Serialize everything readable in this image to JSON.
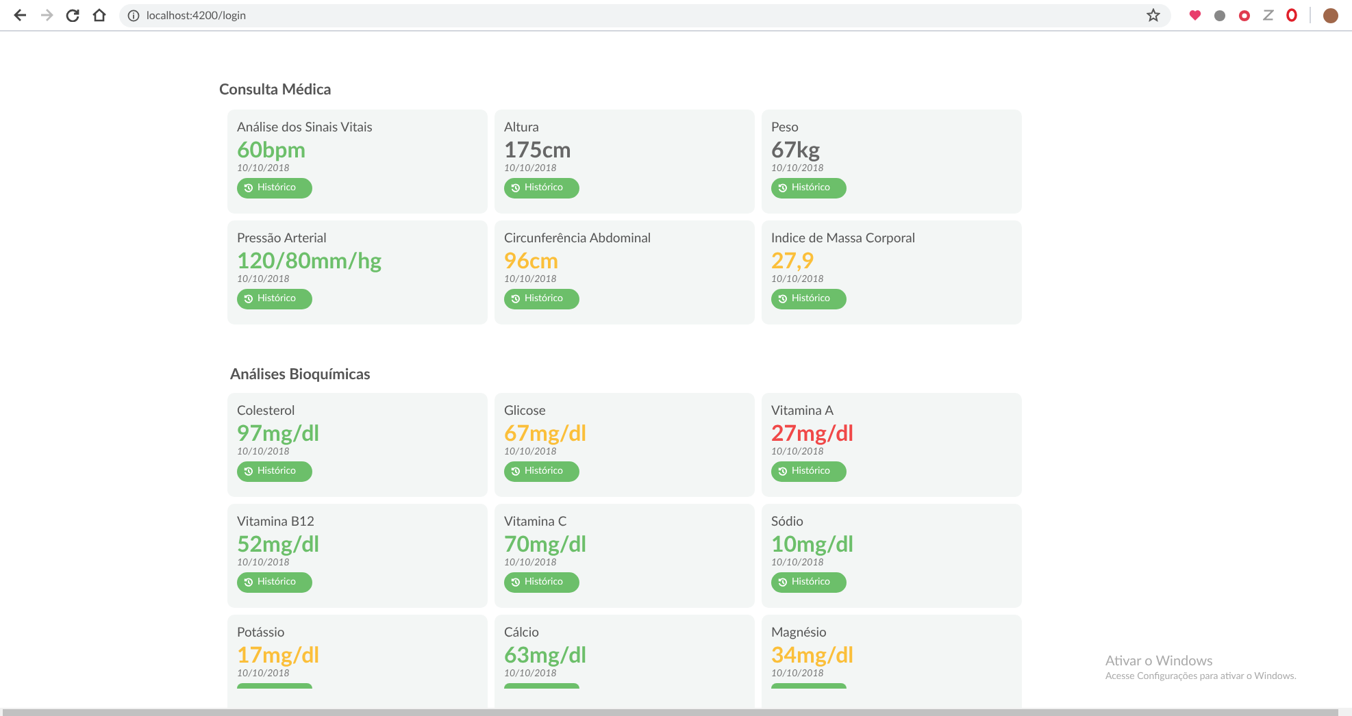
{
  "browser": {
    "url": "localhost:4200/login"
  },
  "sections": [
    {
      "title": "Consulta Médica",
      "cards": [
        {
          "label": "Análise dos Sinais Vitais",
          "value": "60bpm",
          "color": "#6cbf6a",
          "date": "10/10/2018",
          "button": "Histórico"
        },
        {
          "label": "Altura",
          "value": "175cm",
          "color": "#666666",
          "date": "10/10/2018",
          "button": "Histórico"
        },
        {
          "label": "Peso",
          "value": "67kg",
          "color": "#666666",
          "date": "10/10/2018",
          "button": "Histórico"
        },
        {
          "label": "Pressão Arterial",
          "value": "120/80mm/hg",
          "color": "#6cbf6a",
          "date": "10/10/2018",
          "button": "Histórico"
        },
        {
          "label": "Circunferência Abdominal",
          "value": "96cm",
          "color": "#fbbf3a",
          "date": "10/10/2018",
          "button": "Histórico"
        },
        {
          "label": "Indice de Massa Corporal",
          "value": "27,9",
          "color": "#fbbf3a",
          "date": "10/10/2018",
          "button": "Histórico"
        }
      ]
    },
    {
      "title": "Análises Bioquímicas",
      "cards": [
        {
          "label": "Colesterol",
          "value": "97mg/dl",
          "color": "#6cbf6a",
          "date": "10/10/2018",
          "button": "Histórico"
        },
        {
          "label": "Glicose",
          "value": "67mg/dl",
          "color": "#fbbf3a",
          "date": "10/10/2018",
          "button": "Histórico"
        },
        {
          "label": "Vitamina A",
          "value": "27mg/dl",
          "color": "#f04848",
          "date": "10/10/2018",
          "button": "Histórico"
        },
        {
          "label": "Vitamina B12",
          "value": "52mg/dl",
          "color": "#6cbf6a",
          "date": "10/10/2018",
          "button": "Histórico"
        },
        {
          "label": "Vitamina C",
          "value": "70mg/dl",
          "color": "#6cbf6a",
          "date": "10/10/2018",
          "button": "Histórico"
        },
        {
          "label": "Sódio",
          "value": "10mg/dl",
          "color": "#6cbf6a",
          "date": "10/10/2018",
          "button": "Histórico"
        },
        {
          "label": "Potássio",
          "value": "17mg/dl",
          "color": "#fbbf3a",
          "date": "10/10/2018"
        },
        {
          "label": "Cálcio",
          "value": "63mg/dl",
          "color": "#6cbf6a",
          "date": "10/10/2018"
        },
        {
          "label": "Magnésio",
          "value": "34mg/dl",
          "color": "#fbbf3a",
          "date": "10/10/2018"
        }
      ]
    }
  ],
  "os_overlay": {
    "title": "Ativar o Windows",
    "subtitle": "Acesse Configurações para ativar o Windows."
  }
}
